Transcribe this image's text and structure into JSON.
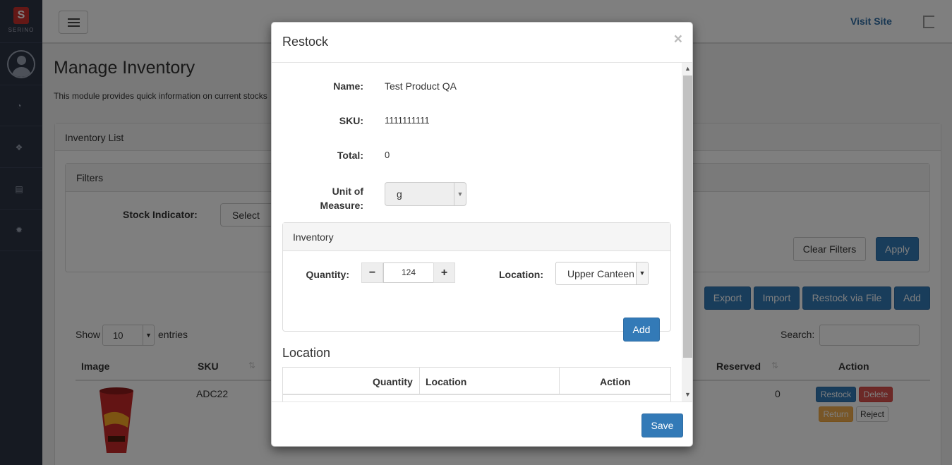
{
  "sidebar": {
    "logo_text": "SERINO",
    "logo_mark": "S"
  },
  "topbar": {
    "visit_site": "Visit Site"
  },
  "main": {
    "title": "Manage Inventory",
    "description": "This module provides quick information on current stocks",
    "panel_title": "Inventory List",
    "filters_title": "Filters",
    "stock_indicator_label": "Stock Indicator:",
    "stock_indicator_value": "Select",
    "clear_filters": "Clear Filters",
    "apply": "Apply",
    "export": "Export",
    "import": "Import",
    "restock_via_file": "Restock via File",
    "add": "Add",
    "show_label": "Show",
    "entries_value": "10",
    "entries_label": "entries",
    "search_label": "Search:",
    "columns": {
      "image": "Image",
      "sku": "SKU",
      "reserved": "Reserved",
      "action": "Action"
    },
    "rows": [
      {
        "sku": "ADC22",
        "reserved": "0",
        "restock": "Restock",
        "delete": "Delete",
        "return": "Return",
        "reject": "Reject"
      }
    ]
  },
  "modal": {
    "title": "Restock",
    "close": "×",
    "name_label": "Name:",
    "name_value": "Test Product QA",
    "sku_label": "SKU:",
    "sku_value": "1111111111",
    "total_label": "Total:",
    "total_value": "0",
    "uom_label_1": "Unit of",
    "uom_label_2": "Measure:",
    "uom_value": "g",
    "inventory_title": "Inventory",
    "quantity_label": "Quantity:",
    "quantity_value": "124",
    "location_label": "Location:",
    "location_value": "Upper Canteen",
    "add_button": "Add",
    "location_heading": "Location",
    "location_columns": {
      "quantity": "Quantity",
      "location": "Location",
      "action": "Action"
    },
    "save": "Save"
  },
  "colors": {
    "primary": "#337ab7",
    "danger": "#d9534f",
    "warning": "#f0ad4e",
    "sidebar": "#2c3445"
  }
}
